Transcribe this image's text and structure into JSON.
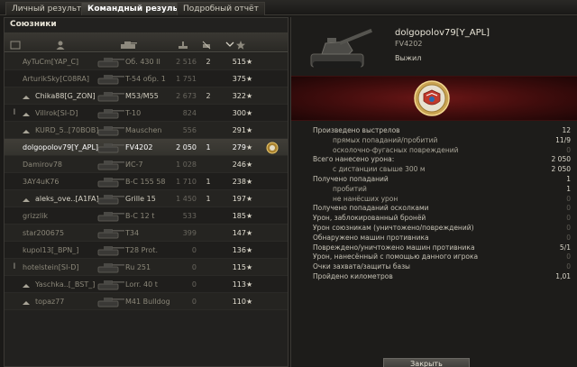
{
  "tabs": [
    {
      "label": "Личный результат"
    },
    {
      "label": "Командный результат"
    },
    {
      "label": "Подробный отчёт"
    }
  ],
  "team": {
    "title": "Союзники",
    "rows": [
      {
        "platoon": "",
        "clan": false,
        "player": "AyTuCm[YAP_C]",
        "tank": "Об. 430 II",
        "damage": "2 516",
        "frags": "2",
        "xp": "515",
        "dead": true,
        "self": false
      },
      {
        "platoon": "",
        "clan": false,
        "player": "ArturikSky[C08RA]",
        "tank": "T-54 обр. 1",
        "damage": "1 751",
        "frags": "",
        "xp": "375",
        "dead": true,
        "self": false
      },
      {
        "platoon": "",
        "clan": true,
        "player": "Chika88[G_ZON]",
        "tank": "M53/M55",
        "damage": "2 673",
        "frags": "2",
        "xp": "322",
        "dead": false,
        "self": false
      },
      {
        "platoon": "I",
        "clan": true,
        "player": "Villrok[SI-D]",
        "tank": "T-10",
        "damage": "824",
        "frags": "",
        "xp": "300",
        "dead": true,
        "self": false
      },
      {
        "platoon": "",
        "clan": true,
        "player": "KURD_5..[70BOB]",
        "tank": "Mauschen",
        "damage": "556",
        "frags": "",
        "xp": "291",
        "dead": true,
        "self": false
      },
      {
        "platoon": "",
        "clan": false,
        "player": "dolgopolov79[Y_APL]",
        "tank": "FV4202",
        "damage": "2 050",
        "frags": "1",
        "xp": "279",
        "dead": false,
        "self": true
      },
      {
        "platoon": "",
        "clan": false,
        "player": "Damirov78",
        "tank": "ИС-7",
        "damage": "1 028",
        "frags": "",
        "xp": "246",
        "dead": true,
        "self": false
      },
      {
        "platoon": "",
        "clan": false,
        "player": "3AY4uK76",
        "tank": "B-C 155 58",
        "damage": "1 710",
        "frags": "1",
        "xp": "238",
        "dead": true,
        "self": false
      },
      {
        "platoon": "",
        "clan": true,
        "player": "aleks_ove..[A1FA]",
        "tank": "Grille 15",
        "damage": "1 450",
        "frags": "1",
        "xp": "197",
        "dead": false,
        "self": false
      },
      {
        "platoon": "",
        "clan": false,
        "player": "grizzlik",
        "tank": "B-C 12 t",
        "damage": "533",
        "frags": "",
        "xp": "185",
        "dead": true,
        "self": false
      },
      {
        "platoon": "",
        "clan": false,
        "player": "star200675",
        "tank": "T34",
        "damage": "399",
        "frags": "",
        "xp": "147",
        "dead": true,
        "self": false
      },
      {
        "platoon": "",
        "clan": false,
        "player": "kupol13[_BPN_]",
        "tank": "T28 Prot.",
        "damage": "0",
        "frags": "",
        "xp": "136",
        "dead": true,
        "self": false
      },
      {
        "platoon": "I",
        "clan": false,
        "player": "hotelstein[SI-D]",
        "tank": "Ru 251",
        "damage": "0",
        "frags": "",
        "xp": "115",
        "dead": true,
        "self": false
      },
      {
        "platoon": "",
        "clan": true,
        "player": "Yaschka..[_BST_]",
        "tank": "Lorr. 40 t",
        "damage": "0",
        "frags": "",
        "xp": "113",
        "dead": true,
        "self": false
      },
      {
        "platoon": "",
        "clan": true,
        "player": "topaz77",
        "tank": "M41 Bulldog",
        "damage": "0",
        "frags": "",
        "xp": "110",
        "dead": true,
        "self": false
      }
    ]
  },
  "details": {
    "player": "dolgopolov79[Y_APL]",
    "vehicle": "FV4202",
    "status": "Выжил",
    "stats": [
      {
        "label": "Произведено выстрелов",
        "value": "12",
        "sub": false
      },
      {
        "label": "прямых попаданий/пробитий",
        "value": "11/9",
        "sub": true
      },
      {
        "label": "осколочно-фугасных повреждений",
        "value": "0",
        "sub": true
      },
      {
        "label": "Всего нанесено урона:",
        "value": "2 050",
        "sub": false
      },
      {
        "label": "с дистанции свыше 300 м",
        "value": "2 050",
        "sub": true
      },
      {
        "label": "Получено попаданий",
        "value": "1",
        "sub": false
      },
      {
        "label": "пробитий",
        "value": "1",
        "sub": true
      },
      {
        "label": "не нанёсших урон",
        "value": "0",
        "sub": true
      },
      {
        "label": "Получено попаданий осколками",
        "value": "0",
        "sub": false
      },
      {
        "label": "Урон, заблокированный бронёй",
        "value": "0",
        "sub": false
      },
      {
        "label": "Урон союзникам (уничтожено/повреждений)",
        "value": "0",
        "sub": false
      },
      {
        "label": "Обнаружено машин противника",
        "value": "0",
        "sub": false
      },
      {
        "label": "Повреждено/уничтожено машин противника",
        "value": "5/1",
        "sub": false
      },
      {
        "label": "Урон, нанесённый с помощью данного игрока",
        "value": "0",
        "sub": false
      },
      {
        "label": "Очки захвата/защиты базы",
        "value": "0",
        "sub": false
      },
      {
        "label": "Пройдено километров",
        "value": "1,01",
        "sub": false
      }
    ],
    "close_label": "Закрыть"
  }
}
